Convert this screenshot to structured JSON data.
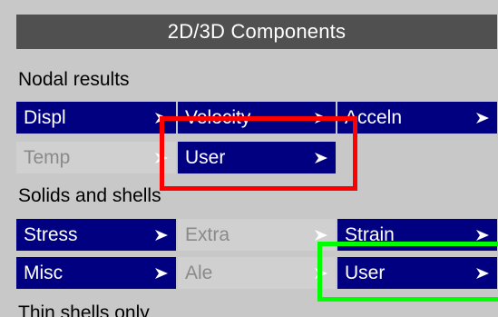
{
  "title": "2D/3D Components",
  "sections": {
    "nodal": "Nodal results",
    "solids": "Solids and shells",
    "thin": "Thin shells only"
  },
  "buttons": {
    "displ": "Displ",
    "velocity": "Velocity",
    "acceln": "Acceln",
    "temp": "Temp",
    "user_nodal": "User",
    "stress": "Stress",
    "extra": "Extra",
    "strain": "Strain",
    "misc": "Misc",
    "ale": "Ale",
    "user_solids": "User"
  },
  "colors": {
    "active_button": "#000080",
    "inactive_button": "#d0d0d0",
    "title_bar": "#505050",
    "highlight_red": "#ff0000",
    "highlight_green": "#00ff00"
  }
}
